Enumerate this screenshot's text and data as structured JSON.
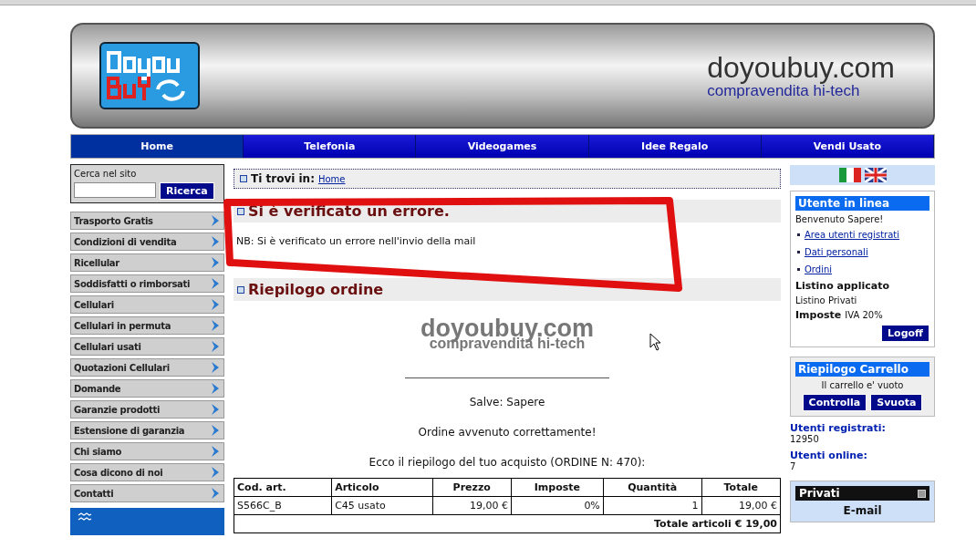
{
  "header": {
    "site_name": "doyoubuy.com",
    "tagline": "compravendita hi-tech"
  },
  "nav": [
    {
      "label": "Home",
      "selected": true
    },
    {
      "label": "Telefonia",
      "selected": false
    },
    {
      "label": "Videogames",
      "selected": false
    },
    {
      "label": "Idee Regalo",
      "selected": false
    },
    {
      "label": "Vendi Usato",
      "selected": false
    }
  ],
  "search": {
    "title": "Cerca nel sito",
    "button": "Ricerca"
  },
  "menu": [
    "Trasporto Gratis",
    "Condizioni di vendita",
    "Ricellular",
    "Soddisfatti o rimborsati",
    "Cellulari",
    "Cellulari in permuta",
    "Cellulari usati",
    "Quotazioni Cellulari",
    "Domande",
    "Garanzie prodotti",
    "Estensione di garanzia",
    "Chi siamo",
    "Cosa dicono di noi",
    "Contatti"
  ],
  "breadcrumb": {
    "label": "Ti trovi in:",
    "link": "Home"
  },
  "error": {
    "title": "Si è verificato un errore.",
    "message": "NB: Si è verificato un errore nell'invio della mail"
  },
  "summary": {
    "title": "Riepilogo ordine",
    "logo_name": "doyoubuy.com",
    "logo_tagline": "compravendita hi-tech",
    "greeting": "Salve: Sapere",
    "confirmation": "Ordine avvenuto correttamente!",
    "intro": "Ecco il riepilogo del tuo acquisto (ORDINE N: 470):",
    "table": {
      "columns": [
        "Cod. art.",
        "Articolo",
        "Prezzo",
        "Imposte",
        "Quantità",
        "Totale"
      ],
      "rows": [
        [
          "S566C_B",
          "C45 usato",
          "19,00 €",
          "0%",
          "1",
          "19,00 €"
        ]
      ],
      "total": "Totale articoli € 19,00"
    }
  },
  "user_box": {
    "title": "Utente in linea",
    "welcome": "Benvenuto Sapere!",
    "links": [
      "Area utenti registrati",
      "Dati personali",
      "Ordini"
    ],
    "pricelist_label": "Listino applicato",
    "pricelist_value": "Listino Privati",
    "tax_label": "Imposte",
    "tax_value": "IVA 20%",
    "logoff": "Logoff"
  },
  "cart": {
    "title": "Riepilogo Carrello",
    "empty": "Il carrello e' vuoto",
    "buttons": [
      "Controlla",
      "Svuota"
    ]
  },
  "stats": [
    {
      "label": "Utenti registrati:",
      "value": "12950"
    },
    {
      "label": "Utenti online:",
      "value": "7"
    }
  ],
  "privati": {
    "title": "Privati",
    "item": "E-mail"
  }
}
